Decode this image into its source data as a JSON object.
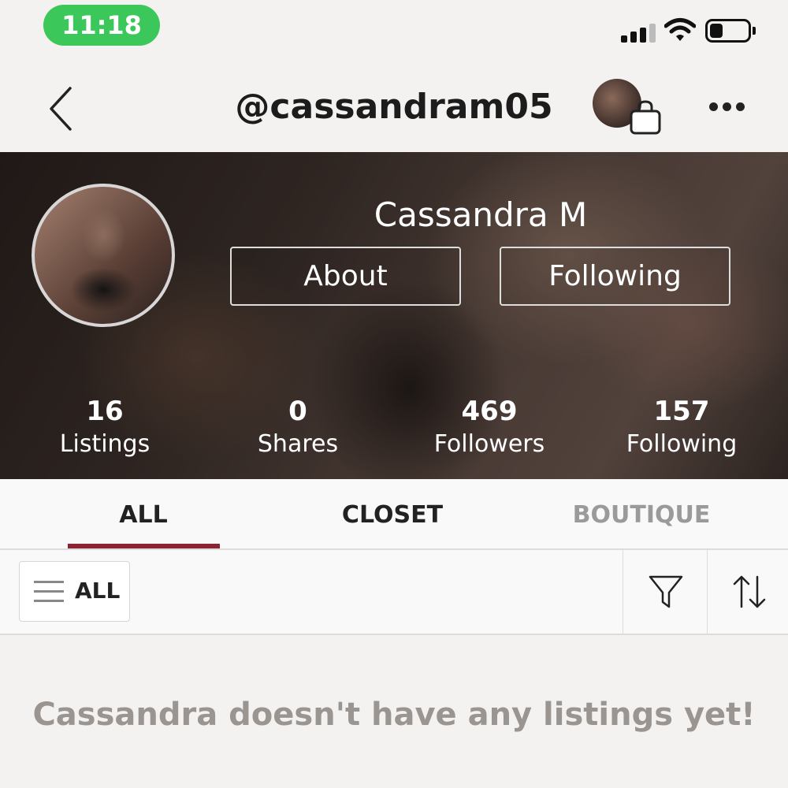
{
  "status_bar": {
    "time": "11:18",
    "icons": [
      "cellular-signal-icon",
      "wifi-icon",
      "battery-icon"
    ],
    "accent": "#3cc75a",
    "battery_level": 0.3,
    "signal_bars_active": 3
  },
  "nav": {
    "title": "@cassandram05",
    "icons": [
      "back-chevron-icon",
      "shopping-bag-icon",
      "more-horizontal-icon"
    ]
  },
  "profile": {
    "name": "Cassandra M",
    "about_label": "About",
    "following_label": "Following",
    "stats": [
      {
        "value": "16",
        "label": "Listings"
      },
      {
        "value": "0",
        "label": "Shares"
      },
      {
        "value": "469",
        "label": "Followers"
      },
      {
        "value": "157",
        "label": "Following"
      }
    ]
  },
  "tabs": {
    "items": [
      {
        "label": "ALL",
        "active": true
      },
      {
        "label": "CLOSET",
        "active": false
      },
      {
        "label": "BOUTIQUE",
        "active": false
      }
    ],
    "indicator_color": "#8a2332"
  },
  "filter_bar": {
    "all_label": "ALL",
    "icons": [
      "menu-icon",
      "filter-funnel-icon",
      "sort-arrows-icon"
    ]
  },
  "empty_state": {
    "message": "Cassandra doesn't have any listings yet!"
  }
}
